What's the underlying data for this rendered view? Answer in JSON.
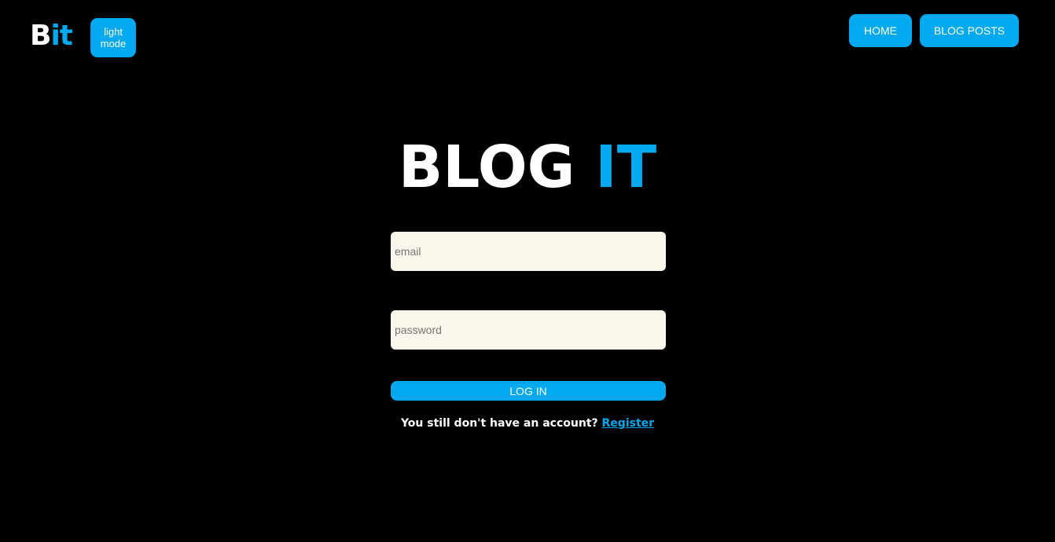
{
  "header": {
    "logo_part1": "B",
    "logo_part2": "it",
    "mode_toggle_label": "light mode",
    "nav": {
      "home_label": "HOME",
      "blog_posts_label": "BLOG POSTS"
    }
  },
  "main": {
    "title_part1": "BLOG ",
    "title_part2": "IT",
    "email_placeholder": "email",
    "email_value": "",
    "password_placeholder": "password",
    "password_value": "",
    "login_label": "LOG IN",
    "register_prompt": "You still don't have an account?",
    "register_link": "Register"
  },
  "colors": {
    "background": "#000000",
    "accent": "#03a9ee",
    "input_background": "#f9f7eb",
    "text": "#ffffff"
  }
}
